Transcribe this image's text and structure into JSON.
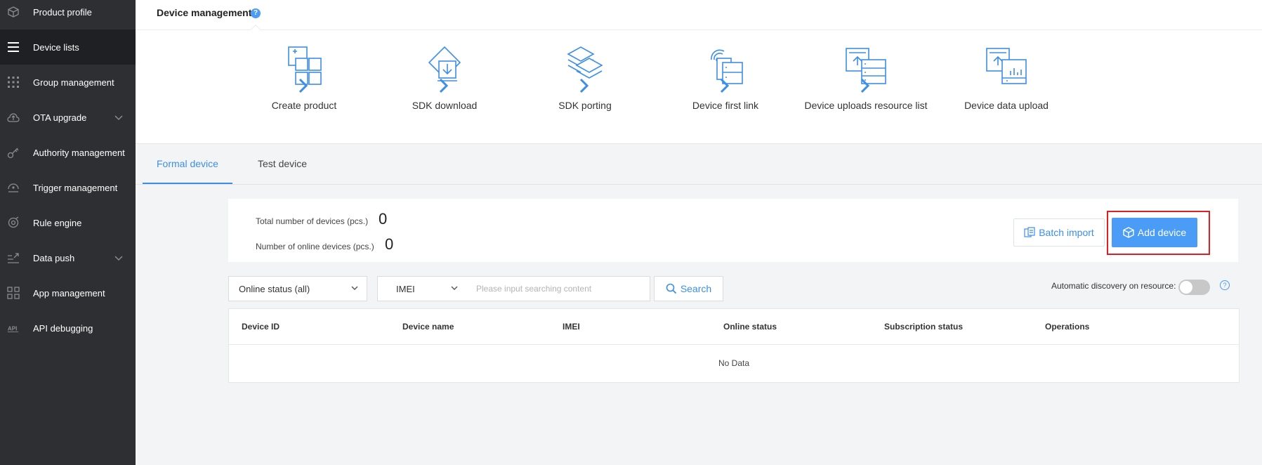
{
  "sidebar": {
    "items": [
      {
        "label": "Product profile",
        "icon": "cube-icon"
      },
      {
        "label": "Device lists",
        "icon": "list-icon",
        "active": true
      },
      {
        "label": "Group management",
        "icon": "grid-dots-icon"
      },
      {
        "label": "OTA upgrade",
        "icon": "cloud-upload-icon",
        "expandable": true
      },
      {
        "label": "Authority management",
        "icon": "key-icon"
      },
      {
        "label": "Trigger management",
        "icon": "trigger-icon"
      },
      {
        "label": "Rule engine",
        "icon": "gear-icon"
      },
      {
        "label": "Data push",
        "icon": "push-icon",
        "expandable": true
      },
      {
        "label": "App management",
        "icon": "apps-icon"
      },
      {
        "label": "API debugging",
        "icon": "api-icon"
      }
    ]
  },
  "header": {
    "title": "Device management",
    "help": "?"
  },
  "steps": [
    {
      "label": "Create product",
      "icon": "create-product-icon"
    },
    {
      "label": "SDK download",
      "icon": "sdk-download-icon"
    },
    {
      "label": "SDK porting",
      "icon": "sdk-porting-icon"
    },
    {
      "label": "Device first link",
      "icon": "device-link-icon"
    },
    {
      "label": "Device uploads resource list",
      "icon": "resource-upload-icon"
    },
    {
      "label": "Device data upload",
      "icon": "data-upload-icon"
    }
  ],
  "tabs": [
    {
      "label": "Formal device",
      "active": true
    },
    {
      "label": "Test device",
      "active": false
    }
  ],
  "stats": {
    "total_label": "Total number of devices (pcs.)",
    "total_value": "0",
    "online_label": "Number of online devices (pcs.)",
    "online_value": "0"
  },
  "actions": {
    "batch_import": "Batch import",
    "add_device": "Add device"
  },
  "filters": {
    "status_selected": "Online status (all)",
    "field_selected": "IMEI",
    "search_placeholder": "Please input searching content",
    "search_value": "",
    "search_button": "Search",
    "auto_discovery_label": "Automatic discovery on resource:",
    "auto_discovery_on": false
  },
  "table": {
    "columns": [
      "Device ID",
      "Device name",
      "IMEI",
      "Online status",
      "Subscription status",
      "Operations"
    ],
    "rows": [],
    "empty_text": "No Data"
  },
  "colors": {
    "accent": "#4a9cf6",
    "sidebar_bg": "#2d2f33",
    "highlight": "#e02020"
  }
}
